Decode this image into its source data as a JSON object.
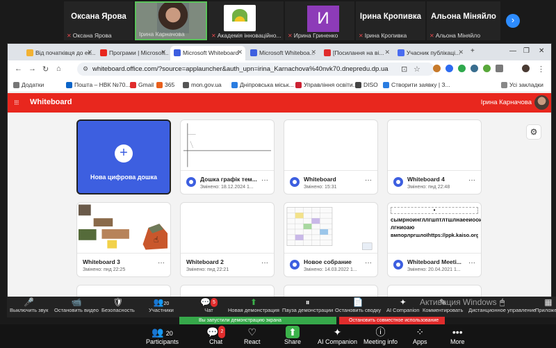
{
  "participants_strip": [
    {
      "name": "Оксана Ярова",
      "sub": "Оксана Ярова",
      "type": "name"
    },
    {
      "name": "",
      "sub": "Ірина Карначова",
      "type": "video"
    },
    {
      "name": "",
      "sub": "Академія інноваційно...",
      "type": "logo"
    },
    {
      "name": "",
      "letter": "И",
      "sub": "Ирина Гриненко",
      "type": "letter"
    },
    {
      "name": "Ірина Кропивка",
      "sub": "Ірина Кропивка",
      "type": "name"
    },
    {
      "name": "Альона Міняйло",
      "sub": "Альона Міняйло",
      "type": "name"
    }
  ],
  "browser": {
    "tabs": [
      {
        "label": "Від початківця до ек...",
        "color": "#f2b233"
      },
      {
        "label": "Програми | Microsoft...",
        "color": "#e8271e"
      },
      {
        "label": "Microsoft Whiteboard",
        "color": "#3d5fe0"
      },
      {
        "label": "Microsoft Whiteboa...",
        "color": "#3d5fe0"
      },
      {
        "label": "[Посилання на ві...",
        "color": "#e02c2c"
      },
      {
        "label": "Учасник публікаці...",
        "color": "#4a6cf0"
      }
    ],
    "new_tab": "+",
    "url": "whiteboard.office.com/?source=applauncher&auth_upn=irina_Karnachova%40nvk70.dnepredu.dp.ua",
    "bookmarks": [
      {
        "label": "Додатки",
        "color": "#777"
      },
      {
        "label": "Пошта – НВК №70...",
        "color": "#0a64c8"
      },
      {
        "label": "Gmail",
        "color": "#e02c2c"
      },
      {
        "label": "365",
        "color": "#e85f1c"
      },
      {
        "label": "mon.gov.ua",
        "color": "#555"
      },
      {
        "label": "Дніпровська міськ...",
        "color": "#2a7de1"
      },
      {
        "label": "Управління освіти...",
        "color": "#c23"
      },
      {
        "label": "DISO",
        "color": "#444"
      },
      {
        "label": "Створити заявку | З...",
        "color": "#2a7de1"
      }
    ],
    "all_bookmarks": "Усі закладки"
  },
  "whiteboard": {
    "app_title": "Whiteboard",
    "user_name": "Ірина Карначова",
    "new_board_label": "Нова цифрова дошка",
    "cards": [
      {
        "title": "Дошка графік тем...",
        "date": "Змінено: 18.12.2024 1...",
        "thumb": "graph"
      },
      {
        "title": "Whiteboard",
        "date": "Змінено: 15:31",
        "thumb": "blank"
      },
      {
        "title": "Whiteboard 4",
        "date": "Змінено: пнд 22:48",
        "thumb": "blank"
      },
      {
        "title": "Whiteboard 3",
        "date": "Змінено: пнд 22:25",
        "thumb": "pictures"
      },
      {
        "title": "Whiteboard 2",
        "date": "Змінено: пнд 22:21",
        "thumb": "blank"
      },
      {
        "title": "Новое собрание",
        "date": "Змінено: 14.03.2022 1...",
        "thumb": "table"
      },
      {
        "title": "Whiteboard Meeti...",
        "date": "Змінено: 20.04.2021 1...",
        "thumb": "text"
      }
    ],
    "text_thumb_lines": [
      "сымрноингллгшптлтшлнаееиоои",
      "лгниоаю",
      "вмпорлргшлоїhttps://ppk.kaiso.org/"
    ]
  },
  "zoom_toolbar": [
    {
      "label": "Выключить звук",
      "icon": "🎤"
    },
    {
      "label": "Остановить видео",
      "icon": "📹"
    },
    {
      "label": "Безопасность",
      "icon": "🛡"
    },
    {
      "label": "Участники",
      "icon": "👥",
      "count": "20"
    },
    {
      "label": "Чат",
      "icon": "💬",
      "badge": "5"
    },
    {
      "label": "Новая демонстрация",
      "icon": "⬆",
      "green": true
    },
    {
      "label": "Пауза демонстрации",
      "icon": "⏸"
    },
    {
      "label": "Остановить сводку",
      "icon": "📄"
    },
    {
      "label": "AI Companion",
      "icon": "✦"
    },
    {
      "label": "Комментировать",
      "icon": "✎"
    },
    {
      "label": "Дистанционное управление",
      "icon": "🖱"
    },
    {
      "label": "Приложе...",
      "icon": "▦"
    }
  ],
  "watermark": "Активация Windows",
  "share_banner": "Вы запустили демонстрацию экрана",
  "stop_banner": "Остановить совместное использование",
  "bottom_bar": [
    {
      "label": "Participants",
      "icon": "👥",
      "count": "20"
    },
    {
      "label": "Chat",
      "icon": "💬",
      "badge": "2"
    },
    {
      "label": "React",
      "icon": "♡"
    },
    {
      "label": "Share",
      "icon": "⬆",
      "green": true
    },
    {
      "label": "AI Companion",
      "icon": "✦"
    },
    {
      "label": "Meeting info",
      "icon": "ⓘ"
    },
    {
      "label": "Apps",
      "icon": "⁘"
    },
    {
      "label": "More",
      "icon": "•••"
    }
  ]
}
